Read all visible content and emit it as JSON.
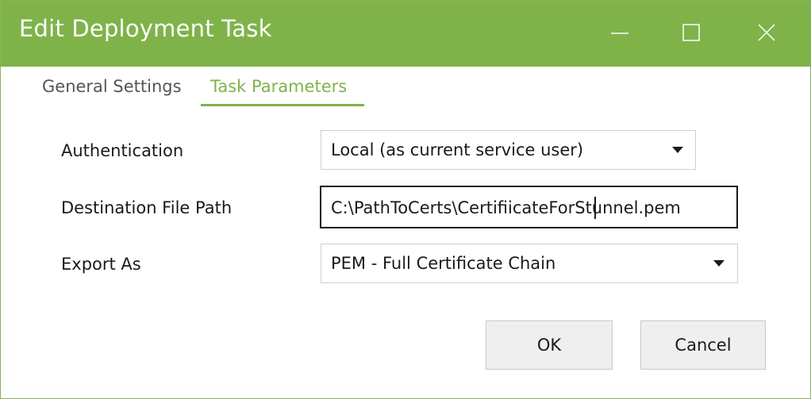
{
  "window": {
    "title": "Edit Deployment Task",
    "accent_color": "#7fb34a",
    "controls": {
      "minimize_icon": "minimize-icon",
      "maximize_icon": "maximize-icon",
      "close_icon": "close-icon"
    }
  },
  "tabs": [
    {
      "label": "General Settings",
      "active": false
    },
    {
      "label": "Task Parameters",
      "active": true
    }
  ],
  "form": {
    "authentication": {
      "label": "Authentication",
      "value": "Local (as current service user)"
    },
    "destination": {
      "label": "Destination File Path",
      "value": "C:\\PathToCerts\\CertifiicateForStunnel.pem"
    },
    "export": {
      "label": "Export As",
      "value": "PEM - Full Certificate Chain"
    }
  },
  "buttons": {
    "ok": "OK",
    "cancel": "Cancel"
  }
}
